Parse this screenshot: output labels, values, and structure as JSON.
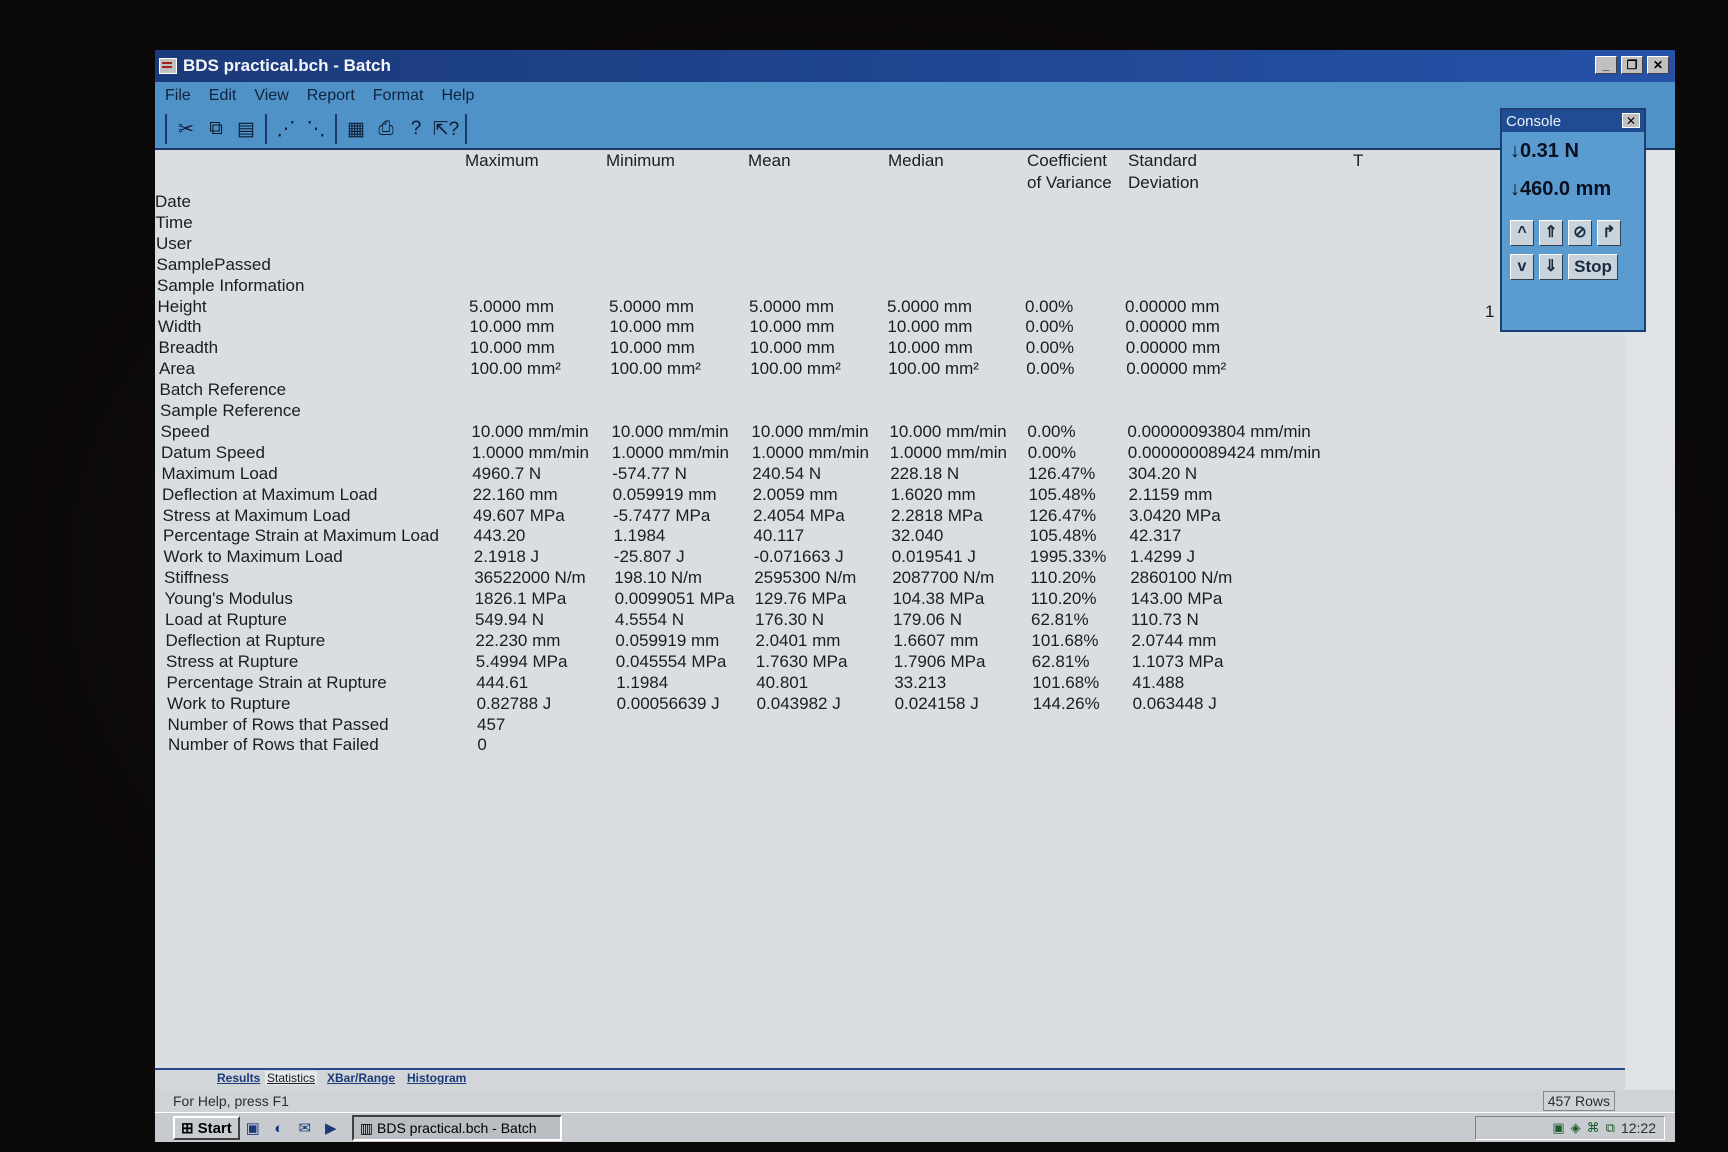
{
  "window": {
    "title": "BDS practical.bch - Batch"
  },
  "menu": [
    "File",
    "Edit",
    "View",
    "Report",
    "Format",
    "Help"
  ],
  "toolbar": [
    "cut-icon",
    "copy-icon",
    "paste-icon",
    "graph-icon",
    "graph-zoom-icon",
    "report-icon",
    "print-icon",
    "help-icon",
    "context-help-icon"
  ],
  "columns": [
    "Maximum",
    "Minimum",
    "Mean",
    "Median",
    "Coefficient\nof Variance",
    "Standard\nDeviation"
  ],
  "header_cut": "T",
  "rows": [
    {
      "label": "Date",
      "values": []
    },
    {
      "label": "Time",
      "values": []
    },
    {
      "label": "User",
      "values": []
    },
    {
      "label": "SamplePassed",
      "values": []
    },
    {
      "label": "Sample Information",
      "values": []
    },
    {
      "label": "Height",
      "values": [
        "5.0000 mm",
        "5.0000 mm",
        "5.0000 mm",
        "5.0000 mm",
        "0.00%",
        "0.00000 mm"
      ]
    },
    {
      "label": "Width",
      "values": [
        "10.000 mm",
        "10.000 mm",
        "10.000 mm",
        "10.000 mm",
        "0.00%",
        "0.00000 mm"
      ]
    },
    {
      "label": "Breadth",
      "values": [
        "10.000 mm",
        "10.000 mm",
        "10.000 mm",
        "10.000 mm",
        "0.00%",
        "0.00000 mm"
      ]
    },
    {
      "label": "Area",
      "values": [
        "100.00 mm²",
        "100.00 mm²",
        "100.00 mm²",
        "100.00 mm²",
        "0.00%",
        "0.00000 mm²"
      ]
    },
    {
      "label": "Batch Reference",
      "values": []
    },
    {
      "label": "Sample Reference",
      "values": []
    },
    {
      "label": "Speed",
      "values": [
        "10.000 mm/min",
        "10.000 mm/min",
        "10.000 mm/min",
        "10.000 mm/min",
        "0.00%",
        "0.00000093804 mm/min"
      ]
    },
    {
      "label": "Datum Speed",
      "values": [
        "1.0000 mm/min",
        "1.0000 mm/min",
        "1.0000 mm/min",
        "1.0000 mm/min",
        "0.00%",
        "0.000000089424 mm/min"
      ]
    },
    {
      "label": "Maximum Load",
      "values": [
        "4960.7 N",
        "-574.77 N",
        "240.54 N",
        "228.18 N",
        "126.47%",
        "304.20 N"
      ]
    },
    {
      "label": "Deflection at Maximum Load",
      "values": [
        "22.160 mm",
        "0.059919 mm",
        "2.0059 mm",
        "1.6020 mm",
        "105.48%",
        "2.1159 mm"
      ]
    },
    {
      "label": "Stress at Maximum Load",
      "values": [
        "49.607 MPa",
        "-5.7477 MPa",
        "2.4054 MPa",
        "2.2818 MPa",
        "126.47%",
        "3.0420 MPa"
      ]
    },
    {
      "label": "Percentage Strain at Maximum Load",
      "values": [
        "443.20",
        "1.1984",
        "40.117",
        "32.040",
        "105.48%",
        "42.317"
      ]
    },
    {
      "label": "Work to Maximum Load",
      "values": [
        "2.1918 J",
        "-25.807 J",
        "-0.071663 J",
        "0.019541 J",
        "1995.33%",
        "1.4299 J"
      ]
    },
    {
      "label": "Stiffness",
      "values": [
        "36522000 N/m",
        "198.10 N/m",
        "2595300 N/m",
        "2087700 N/m",
        "110.20%",
        "2860100 N/m"
      ]
    },
    {
      "label": "Young's Modulus",
      "values": [
        "1826.1 MPa",
        "0.0099051 MPa",
        "129.76 MPa",
        "104.38 MPa",
        "110.20%",
        "143.00 MPa"
      ]
    },
    {
      "label": "Load at Rupture",
      "values": [
        "549.94 N",
        "4.5554 N",
        "176.30 N",
        "179.06 N",
        "62.81%",
        "110.73 N"
      ]
    },
    {
      "label": "Deflection at Rupture",
      "values": [
        "22.230 mm",
        "0.059919 mm",
        "2.0401 mm",
        "1.6607 mm",
        "101.68%",
        "2.0744 mm"
      ]
    },
    {
      "label": "Stress at Rupture",
      "values": [
        "5.4994 MPa",
        "0.045554 MPa",
        "1.7630 MPa",
        "1.7906 MPa",
        "62.81%",
        "1.1073 MPa"
      ]
    },
    {
      "label": "Percentage Strain at Rupture",
      "values": [
        "444.61",
        "1.1984",
        "40.801",
        "33.213",
        "101.68%",
        "41.488"
      ]
    },
    {
      "label": "Work to Rupture",
      "values": [
        "0.82788 J",
        "0.00056639 J",
        "0.043982 J",
        "0.024158 J",
        "144.26%",
        "0.063448 J"
      ]
    },
    {
      "label": "Number of Rows that Passed",
      "values": [
        "457"
      ]
    },
    {
      "label": "Number of Rows that Failed",
      "values": [
        "0"
      ]
    }
  ],
  "console": {
    "title": "Console",
    "load": "↓0.31 N",
    "position": "↓460.0 mm",
    "buttons": [
      "^",
      "⇑",
      "⊘",
      "↱",
      "v",
      "⇓"
    ],
    "stop_label": "Stop",
    "side_cut": "1"
  },
  "tabs": [
    "Results",
    "Statistics",
    "XBar/Range",
    "Histogram"
  ],
  "active_tab": "Statistics",
  "status": {
    "help": "For Help, press F1",
    "rows": "457 Rows"
  },
  "taskbar": {
    "start": "Start",
    "item": "BDS practical.bch - Batch",
    "clock": "12:22"
  }
}
